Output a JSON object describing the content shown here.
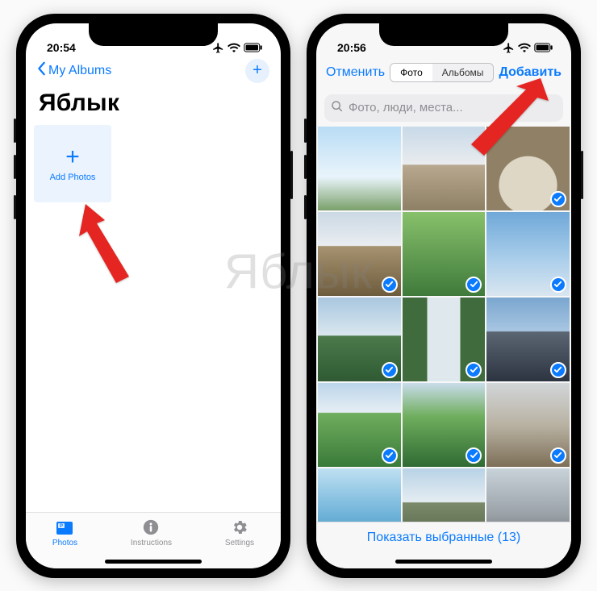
{
  "watermark": "Яблык",
  "left": {
    "status": {
      "time": "20:54"
    },
    "nav": {
      "back_label": "My Albums",
      "plus_glyph": "+"
    },
    "title": "Яблык",
    "add_tile": {
      "plus_glyph": "+",
      "label": "Add Photos"
    },
    "tabs": {
      "photos": "Photos",
      "instructions": "Instructions",
      "settings": "Settings"
    }
  },
  "right": {
    "status": {
      "time": "20:56"
    },
    "picker": {
      "cancel": "Отменить",
      "seg_photos": "Фото",
      "seg_albums": "Альбомы",
      "add": "Добавить"
    },
    "search": {
      "placeholder": "Фото, люди, места..."
    },
    "footer": {
      "show_selected": "Показать выбранные (13)"
    },
    "thumbs": [
      {
        "cls": "sky1",
        "sel": false
      },
      {
        "cls": "bld1",
        "sel": false
      },
      {
        "cls": "arch",
        "sel": true
      },
      {
        "cls": "ruin",
        "sel": true
      },
      {
        "cls": "grn1",
        "sel": true
      },
      {
        "cls": "stat",
        "sel": true
      },
      {
        "cls": "mtn",
        "sel": true
      },
      {
        "cls": "fall",
        "sel": true
      },
      {
        "cls": "hot",
        "sel": true
      },
      {
        "cls": "hill",
        "sel": true
      },
      {
        "cls": "vall",
        "sel": true
      },
      {
        "cls": "city",
        "sel": true
      },
      {
        "cls": "lake",
        "sel": true
      },
      {
        "cls": "peak",
        "sel": true
      },
      {
        "cls": "car",
        "sel": true
      }
    ]
  }
}
